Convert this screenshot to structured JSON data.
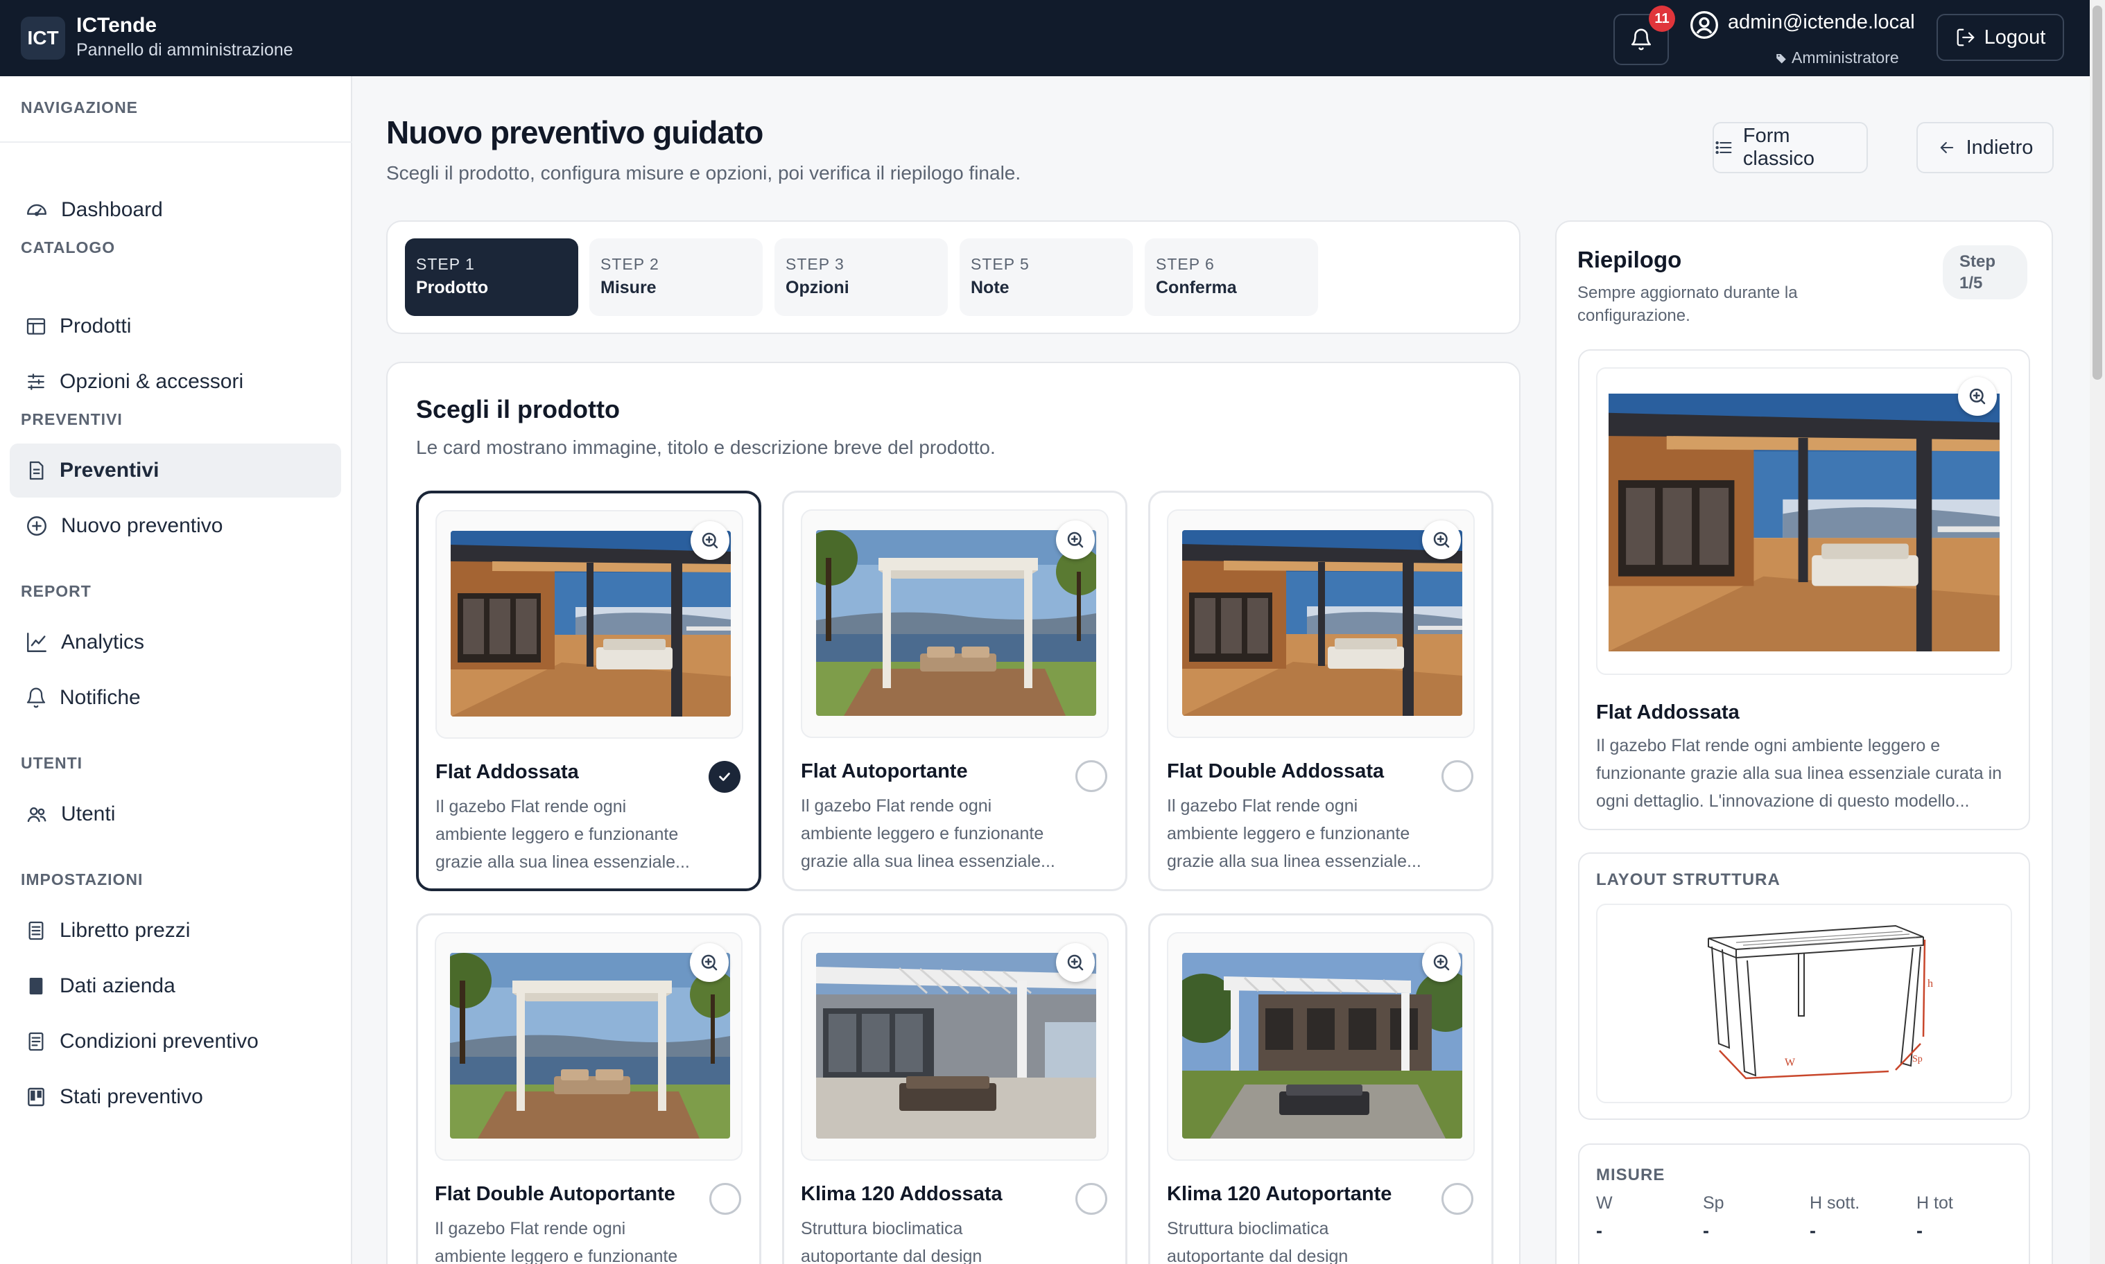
{
  "app": {
    "logo_text": "ICT",
    "name": "ICTende",
    "subtitle": "Pannello di amministrazione",
    "notifications_count": "11",
    "user_email": "admin@ictende.local",
    "user_role": "Amministratore",
    "logout_label": "Logout"
  },
  "sidebar": {
    "nav_heading": "NAVIGAZIONE",
    "dashboard": "Dashboard",
    "catalogo_heading": "CATALOGO",
    "prodotti": "Prodotti",
    "opzioni": "Opzioni & accessori",
    "preventivi_heading": "PREVENTIVI",
    "preventivi": "Preventivi",
    "nuovo_preventivo": "Nuovo preventivo",
    "report_heading": "REPORT",
    "analytics": "Analytics",
    "notifiche": "Notifiche",
    "utenti_heading": "UTENTI",
    "utenti": "Utenti",
    "impostazioni_heading": "IMPOSTAZIONI",
    "libretto": "Libretto prezzi",
    "dati_azienda": "Dati azienda",
    "condizioni": "Condizioni preventivo",
    "stati": "Stati preventivo"
  },
  "page": {
    "title": "Nuovo preventivo guidato",
    "subtitle": "Scegli il prodotto, configura misure e opzioni, poi verifica il riepilogo finale.",
    "form_classico": "Form classico",
    "indietro": "Indietro"
  },
  "steps": [
    {
      "num": "STEP 1",
      "name": "Prodotto"
    },
    {
      "num": "STEP 2",
      "name": "Misure"
    },
    {
      "num": "STEP 3",
      "name": "Opzioni"
    },
    {
      "num": "STEP 5",
      "name": "Note"
    },
    {
      "num": "STEP 6",
      "name": "Conferma"
    }
  ],
  "product_section": {
    "title": "Scegli il prodotto",
    "subtitle": "Le card mostrano immagine, titolo e descrizione breve del prodotto."
  },
  "products": [
    {
      "name": "Flat Addossata",
      "desc_1": "Il gazebo Flat rende ogni",
      "desc_2": "ambiente leggero e funzionante",
      "desc_3": "grazie alla sua linea essenziale...",
      "selected": true
    },
    {
      "name": "Flat Autoportante",
      "desc_1": "Il gazebo Flat rende ogni",
      "desc_2": "ambiente leggero e funzionante",
      "desc_3": "grazie alla sua linea essenziale...",
      "selected": false
    },
    {
      "name": "Flat Double Addossata",
      "desc_1": "Il gazebo Flat rende ogni",
      "desc_2": "ambiente leggero e funzionante",
      "desc_3": "grazie alla sua linea essenziale...",
      "selected": false
    },
    {
      "name": "Flat Double Autoportante",
      "desc_1": "Il gazebo Flat rende ogni",
      "desc_2": "ambiente leggero e funzionante",
      "desc_3": "",
      "selected": false
    },
    {
      "name": "Klima 120 Addossata",
      "desc_1": "Struttura bioclimatica",
      "desc_2": "autoportante dal design",
      "desc_3": "",
      "selected": false
    },
    {
      "name": "Klima 120 Autoportante",
      "desc_1": "Struttura bioclimatica",
      "desc_2": "autoportante dal design",
      "desc_3": "",
      "selected": false
    }
  ],
  "recap": {
    "title": "Riepilogo",
    "subtitle": "Sempre aggiornato durante la configurazione.",
    "step_label": "Step",
    "step_value": "1/5",
    "product_name": "Flat Addossata",
    "product_desc_1": "Il gazebo Flat rende ogni ambiente leggero e",
    "product_desc_2": "funzionante grazie alla sua linea essenziale curata in",
    "product_desc_3": "ogni dettaglio. L'innovazione di questo modello...",
    "layout_heading": "LAYOUT STRUTTURA",
    "dim_w": "W",
    "dim_sp": "Sp",
    "dim_h": "h",
    "misure_heading": "MISURE",
    "misure": [
      {
        "label": "W",
        "value": "-"
      },
      {
        "label": "Sp",
        "value": "-"
      },
      {
        "label": "H sott.",
        "value": "-"
      },
      {
        "label": "H tot",
        "value": "-"
      }
    ]
  },
  "colors": {
    "topbar": "#111b2b",
    "accent_dark": "#1b2638",
    "badge": "#e0353b"
  }
}
